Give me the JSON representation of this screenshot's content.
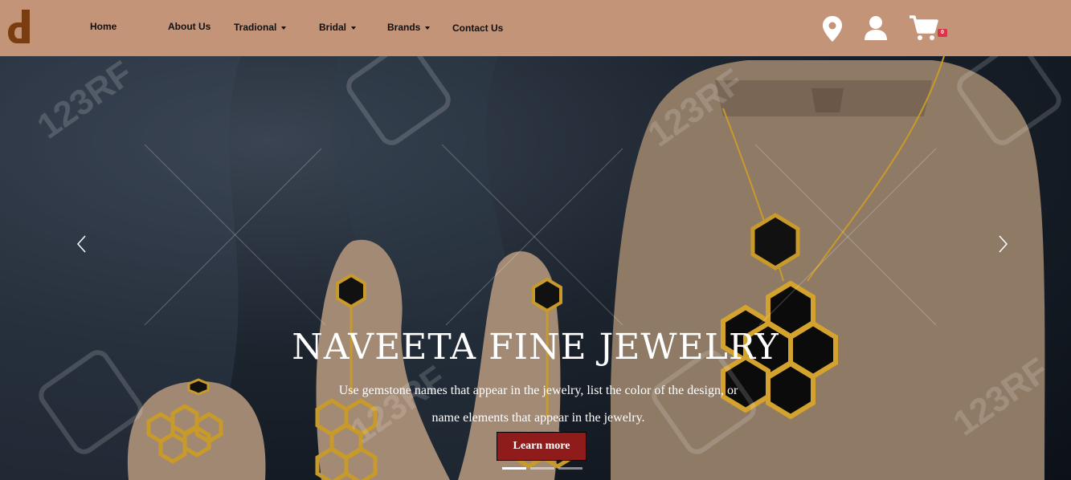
{
  "nav": {
    "links": [
      {
        "label": "Home",
        "dropdown": false
      },
      {
        "label": "About Us",
        "dropdown": false
      },
      {
        "label": "Tradional",
        "dropdown": true
      },
      {
        "label": "Bridal",
        "dropdown": true
      },
      {
        "label": "Brands",
        "dropdown": true
      },
      {
        "label": "Contact Us",
        "dropdown": false
      }
    ],
    "cart_count": "0",
    "icons": [
      "location-pin-icon",
      "user-icon",
      "cart-icon"
    ]
  },
  "hero": {
    "title": "NAVEETA FINE JEWELRY",
    "subtitle_line1": "Use gemstone names that appear in the jewelry, list the color of the design, or",
    "subtitle_line2": "name elements that appear in the jewelry.",
    "cta_label": "Learn more",
    "watermark_text": "123RF",
    "slide_count": 3,
    "active_slide": 1
  },
  "colors": {
    "nav_bg": "#c49479",
    "logo": "#7a3d10",
    "cta_bg": "#8f1b1b",
    "badge": "#d9354a"
  }
}
